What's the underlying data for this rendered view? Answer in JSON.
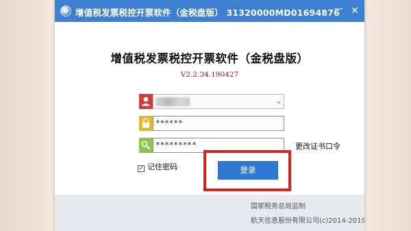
{
  "window": {
    "title": "增值税发票税控开票软件（金税盘版）  31320000MD01694876",
    "minimize_glyph": "—",
    "close_glyph": "✕"
  },
  "login": {
    "heading": "增值税发票税控开票软件（金税盘版）",
    "version": "V2.2.34.190427",
    "user_select": {
      "value": "",
      "icon": "user-icon",
      "chevron": "⌄"
    },
    "password_field": {
      "value": "******",
      "icon": "lock-icon"
    },
    "cert_password_field": {
      "value": "*********",
      "icon": "key-icon"
    },
    "change_cert_password_label": "更改证书口令",
    "remember_password": {
      "label": "记住密码",
      "checked": true,
      "check_glyph": "✓"
    },
    "login_button": "登录"
  },
  "footer": {
    "line1": "国家税务总局监制",
    "line2": "航天信息股份有限公司(c)2014-2019"
  },
  "colors": {
    "titlebar": "#3d7fd0",
    "login_button": "#2f79d4",
    "highlight_box": "#dd1f1f",
    "version_text": "#b01515"
  }
}
